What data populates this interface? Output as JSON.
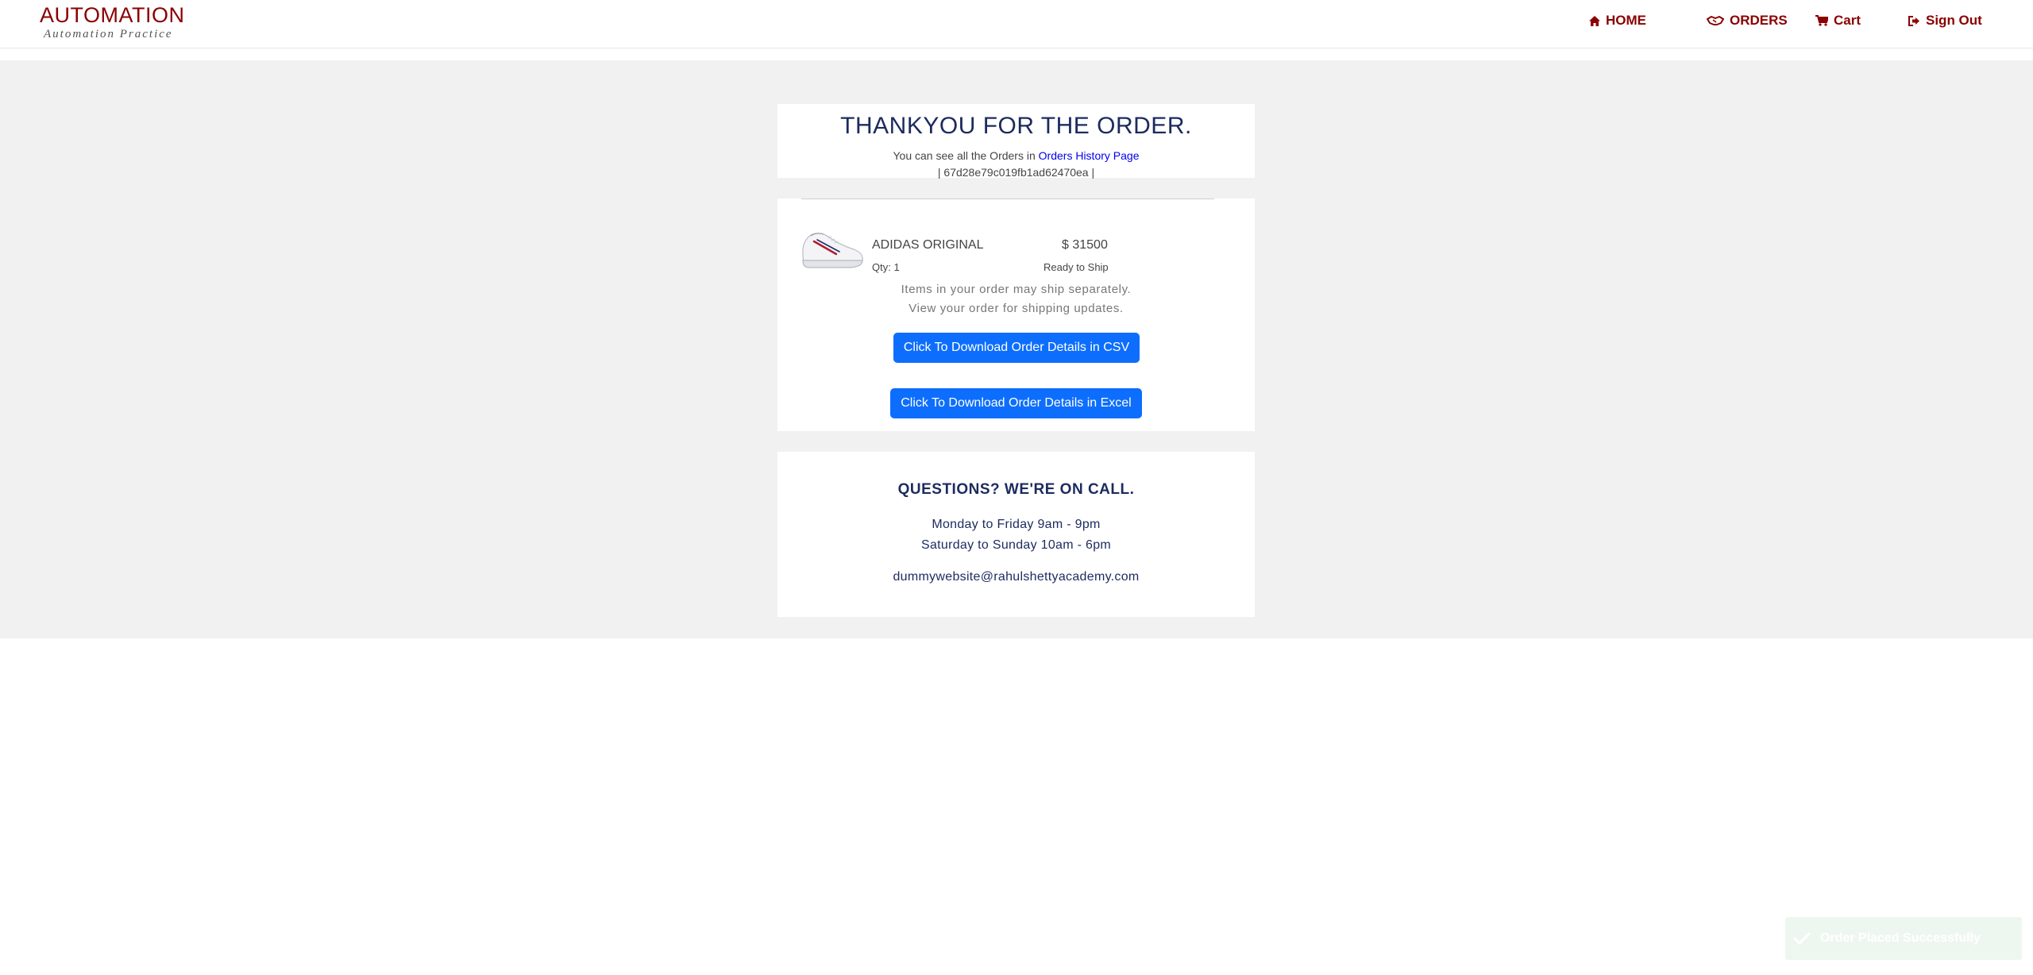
{
  "header": {
    "brand_title": "AUTOMATION",
    "brand_subtitle": "Automation Practice",
    "brand_color": "#8b0000",
    "nav": [
      {
        "label": "HOME",
        "icon": "home-icon"
      },
      {
        "label": "ORDERS",
        "icon": "handshake-icon"
      },
      {
        "label": "Cart",
        "icon": "cart-icon"
      },
      {
        "label": "Sign Out",
        "icon": "sign-out-icon"
      }
    ]
  },
  "thanks": {
    "title": "THANKYOU FOR THE ORDER.",
    "subtitle_prefix": "You can see all the Orders in ",
    "history_link": "Orders History Page",
    "order_id": "| 67d28e79c019fb1ad62470ea |"
  },
  "order": {
    "items": [
      {
        "name": "ADIDAS ORIGINAL",
        "price": "$ 31500",
        "qty": "Qty: 1",
        "status": "Ready to Ship",
        "image": "shoe-image"
      }
    ],
    "ship_note_1": "Items in your order may ship separately.",
    "ship_note_2": "View your order for shipping updates.",
    "download_csv": "Click To Download Order Details in CSV",
    "download_excel": "Click To Download Order Details in Excel",
    "button_color": "#0d6efd"
  },
  "contact": {
    "title": "QUESTIONS? WE'RE ON CALL.",
    "hours_weekday": "Monday to Friday 9am - 9pm",
    "hours_weekend": "Saturday to Sunday 10am - 6pm",
    "email": "dummywebsite@rahulshettyacademy.com"
  },
  "toast": {
    "message": "Order Placed Successfully",
    "icon": "check-icon"
  }
}
